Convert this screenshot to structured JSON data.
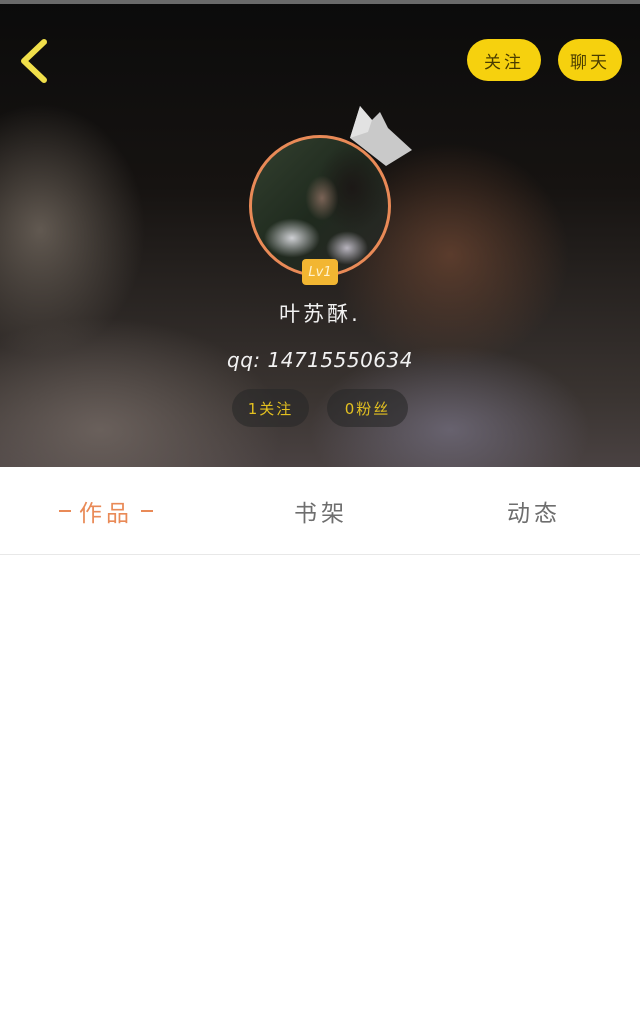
{
  "header": {
    "follow_label": "关注",
    "chat_label": "聊天"
  },
  "profile": {
    "level": "Lv1",
    "username": "叶苏酥.",
    "qq": "qq: 14715550634",
    "following": "1关注",
    "fans": "0粉丝"
  },
  "tabs": [
    {
      "label": "作品",
      "active": true
    },
    {
      "label": "书架",
      "active": false
    },
    {
      "label": "动态",
      "active": false
    }
  ],
  "colors": {
    "accent": "#e98a57",
    "button_yellow": "#f6d10e",
    "stat_text": "#e3c020"
  },
  "icons": {
    "back": "chevron-left-icon",
    "crown": "crown-icon"
  }
}
